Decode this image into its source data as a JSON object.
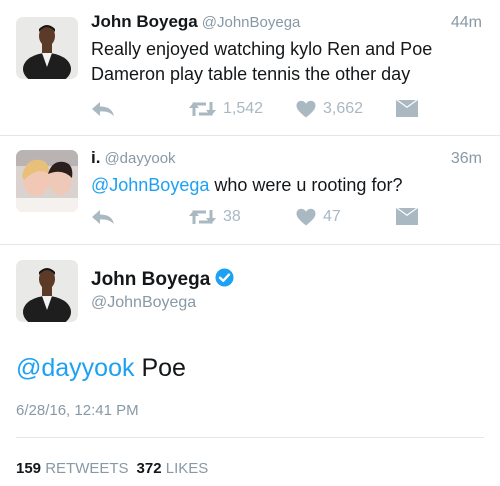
{
  "tweets": [
    {
      "name": "John Boyega",
      "handle": "@JohnBoyega",
      "time": "44m",
      "text": "Really enjoyed watching kylo Ren and Poe Dameron play table tennis the other day",
      "retweets": "1,542",
      "likes": "3,662"
    },
    {
      "name": "i.",
      "handle": "@dayyook",
      "time": "36m",
      "mention": "@JohnBoyega",
      "text": " who were u rooting for?",
      "retweets": "38",
      "likes": "47"
    }
  ],
  "detail": {
    "name": "John Boyega",
    "handle": "@JohnBoyega",
    "mention": "@dayyook",
    "text": " Poe",
    "timestamp": "6/28/16, 12:41 PM",
    "retweet_count": "159",
    "retweet_label": "RETWEETS",
    "like_count": "372",
    "like_label": "LIKES"
  },
  "colors": {
    "link": "#1da1f2",
    "muted": "#8899a6",
    "icon": "#aab8c2",
    "divider": "#e1e8ed"
  }
}
